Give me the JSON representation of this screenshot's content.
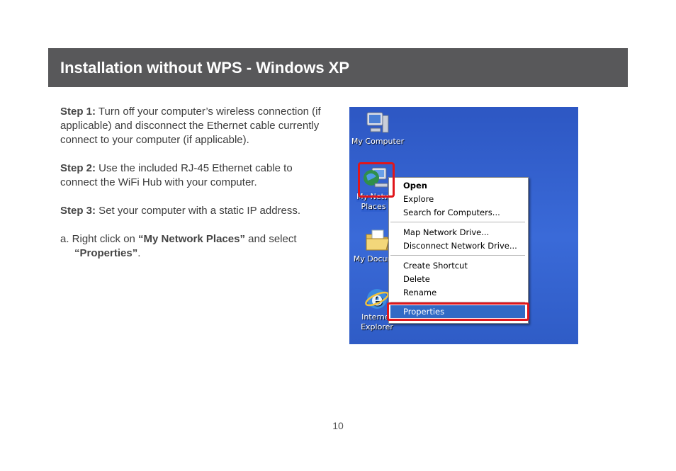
{
  "header": {
    "title": "Installation without WPS - Windows XP"
  },
  "colors": {
    "header_bg": "#58585a",
    "highlight_red": "#e0161b",
    "xp_selection": "#316ac5",
    "desktop_blue": "#3a6ad8"
  },
  "steps": [
    {
      "label": "Step 1:",
      "text": " Turn off your computer’s wireless connection (if applicable) and disconnect the Ethernet cable currently connect to your computer (if applicable)."
    },
    {
      "label": "Step 2:",
      "text": " Use the included RJ-45 Ethernet cable to connect the WiFi Hub with your computer."
    },
    {
      "label": "Step 3:",
      "text": " Set your computer with a static IP address."
    }
  ],
  "substep": {
    "prefix": "a. Right click on ",
    "target": "“My Network Places”",
    "middle": " and select",
    "action": "“Properties”",
    "suffix": "."
  },
  "screenshot": {
    "desktop_icons": [
      {
        "label": "My Computer",
        "icon": "computer-icon"
      },
      {
        "label_line1": "My Netw",
        "label_line2": "Places",
        "icon": "network-places-icon"
      },
      {
        "label": "My Docum",
        "icon": "documents-folder-icon"
      },
      {
        "label_line1": "Internet",
        "label_line2": "Explorer",
        "icon": "internet-explorer-icon"
      }
    ],
    "context_menu": {
      "items": [
        "Open",
        "Explore",
        "Search for Computers...",
        "Map Network Drive...",
        "Disconnect Network Drive...",
        "Create Shortcut",
        "Delete",
        "Rename",
        "Properties"
      ],
      "default_item": "Open",
      "selected_item": "Properties"
    }
  },
  "page_number": "10"
}
